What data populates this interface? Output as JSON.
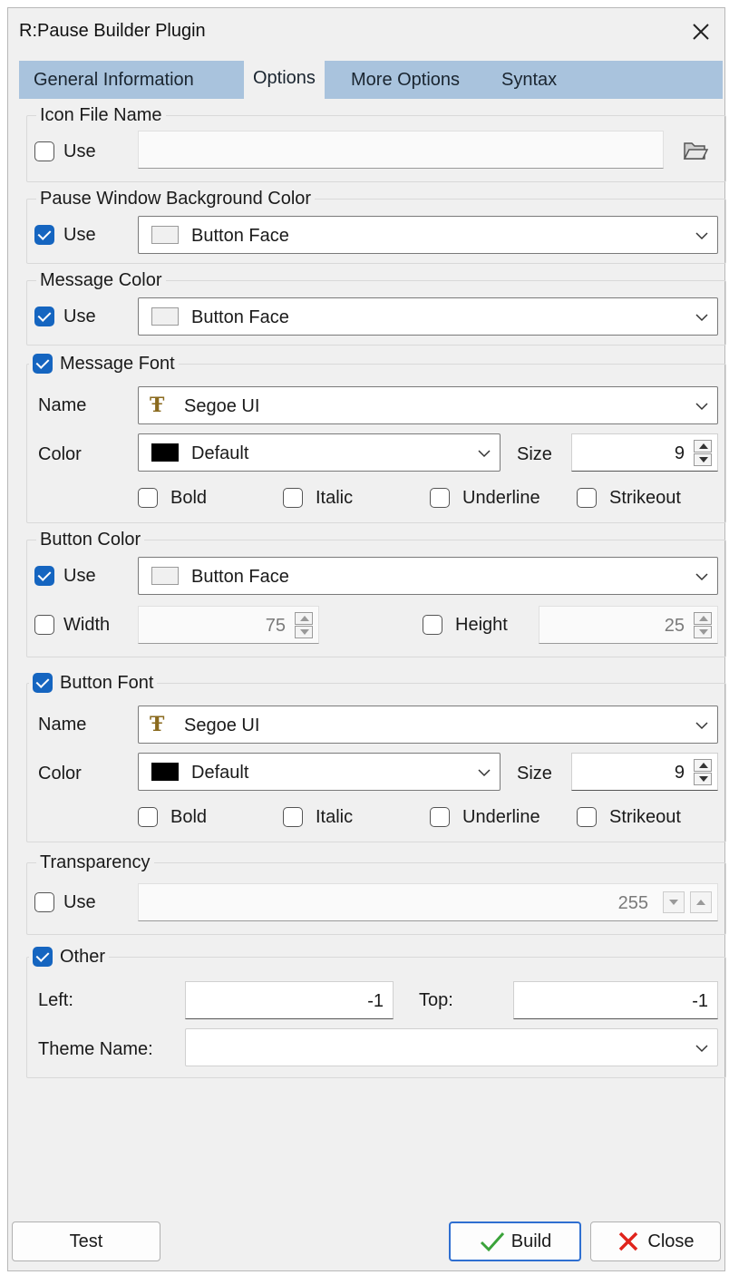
{
  "window": {
    "title": "R:Pause Builder Plugin"
  },
  "tabs": [
    "General Information",
    "Options",
    "More Options",
    "Syntax"
  ],
  "icon_file": {
    "legend": "Icon File Name",
    "use_label": "Use",
    "use_checked": false,
    "value": ""
  },
  "bg_color": {
    "legend": "Pause Window Background Color",
    "use_label": "Use",
    "use_checked": true,
    "value": "Button Face"
  },
  "message_color": {
    "legend": "Message Color",
    "use_label": "Use",
    "use_checked": true,
    "value": "Button Face"
  },
  "message_font": {
    "legend": "Message Font",
    "checked": true,
    "name_label": "Name",
    "name_value": "Segoe UI",
    "color_label": "Color",
    "color_value": "Default",
    "size_label": "Size",
    "size_value": "9",
    "bold": "Bold",
    "italic": "Italic",
    "underline": "Underline",
    "strikeout": "Strikeout"
  },
  "button_color": {
    "legend": "Button Color",
    "use_label": "Use",
    "use_checked": true,
    "value": "Button Face",
    "width_label": "Width",
    "width_value": "75",
    "height_label": "Height",
    "height_value": "25"
  },
  "button_font": {
    "legend": "Button Font",
    "checked": true,
    "name_label": "Name",
    "name_value": "Segoe UI",
    "color_label": "Color",
    "color_value": "Default",
    "size_label": "Size",
    "size_value": "9",
    "bold": "Bold",
    "italic": "Italic",
    "underline": "Underline",
    "strikeout": "Strikeout"
  },
  "transparency": {
    "legend": "Transparency",
    "use_label": "Use",
    "use_checked": false,
    "value": "255"
  },
  "other": {
    "legend": "Other",
    "checked": true,
    "left_label": "Left:",
    "left_value": "-1",
    "top_label": "Top:",
    "top_value": "-1",
    "theme_label": "Theme Name:",
    "theme_value": ""
  },
  "footer": {
    "test": "Test",
    "build": "Build",
    "close": "Close"
  },
  "colors": {
    "accent": "#1565c0",
    "tabbar": "#a9c3dd",
    "build_border": "#2f6fd1",
    "close_x": "#e0241c",
    "build_check": "#3aa33a"
  }
}
